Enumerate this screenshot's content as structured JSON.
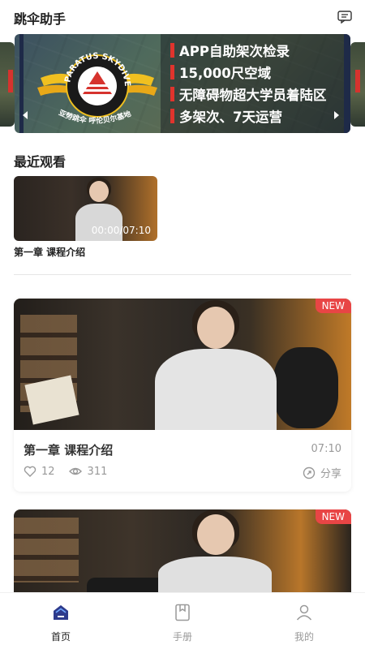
{
  "header": {
    "title": "跳伞助手",
    "message_icon": "message-icon"
  },
  "banner": {
    "logo_text_top": "PARATUS SKYDIVE",
    "logo_text_bottom": "亚勞跳伞 呼伦贝尔基地",
    "lines": [
      "APP自助架次检录",
      "15,000尺空域",
      "无障碍物超大学员着陆区",
      "多架次、7天运营"
    ]
  },
  "recent": {
    "section_title": "最近观看",
    "item": {
      "time": "00:00/07:10",
      "title": "第一章 课程介绍"
    }
  },
  "feed": [
    {
      "badge": "NEW",
      "title": "第一章 课程介绍",
      "duration": "07:10",
      "likes": "12",
      "views": "311",
      "share_label": "分享"
    },
    {
      "badge": "NEW"
    }
  ],
  "tabbar": {
    "tabs": [
      {
        "label": "首页",
        "icon": "home-icon",
        "active": true
      },
      {
        "label": "手册",
        "icon": "manual-icon",
        "active": false
      },
      {
        "label": "我的",
        "icon": "profile-icon",
        "active": false
      }
    ]
  },
  "colors": {
    "accent": "#2d3a8c",
    "badge": "#e84545",
    "banner_bar": "#e0342d"
  }
}
